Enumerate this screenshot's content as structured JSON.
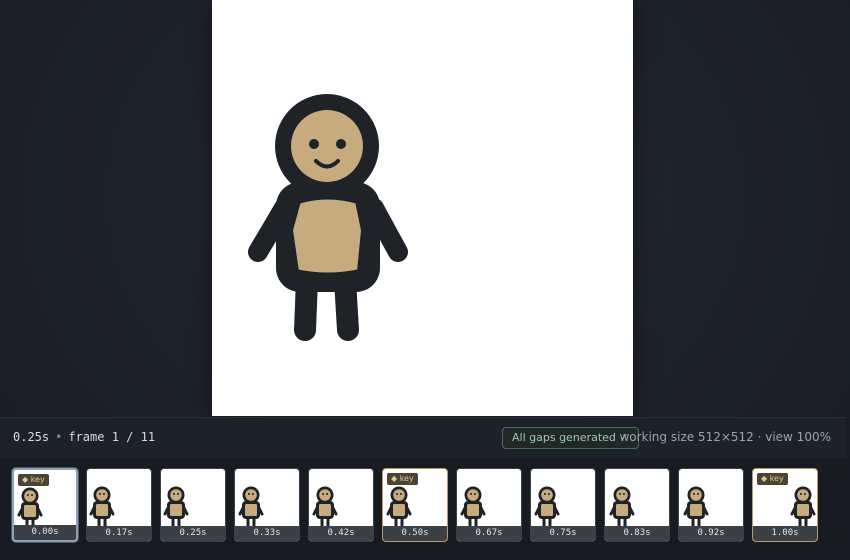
{
  "status": {
    "time": "0.25s",
    "separator": "•",
    "frame_label": "frame 1 / 11",
    "gaps_badge": "All gaps generated ✓",
    "working_size": "working size 512×512 · view 100%"
  },
  "colors": {
    "outline": "#1f2226",
    "skin": "#c7ab7f",
    "canvas": "#ffffff",
    "key_border": "#b59a6a",
    "selected_border": "#8fa2b5"
  },
  "timeline": {
    "key_label": "◆ key",
    "frames": [
      {
        "time": "0.00s",
        "key": true,
        "selected": true
      },
      {
        "time": "0.17s",
        "key": false,
        "selected": false
      },
      {
        "time": "0.25s",
        "key": false,
        "selected": false
      },
      {
        "time": "0.33s",
        "key": false,
        "selected": false
      },
      {
        "time": "0.42s",
        "key": false,
        "selected": false
      },
      {
        "time": "0.50s",
        "key": true,
        "selected": false
      },
      {
        "time": "0.67s",
        "key": false,
        "selected": false
      },
      {
        "time": "0.75s",
        "key": false,
        "selected": false
      },
      {
        "time": "0.83s",
        "key": false,
        "selected": false
      },
      {
        "time": "0.92s",
        "key": false,
        "selected": false
      },
      {
        "time": "1.00s",
        "key": true,
        "selected": false
      }
    ]
  }
}
